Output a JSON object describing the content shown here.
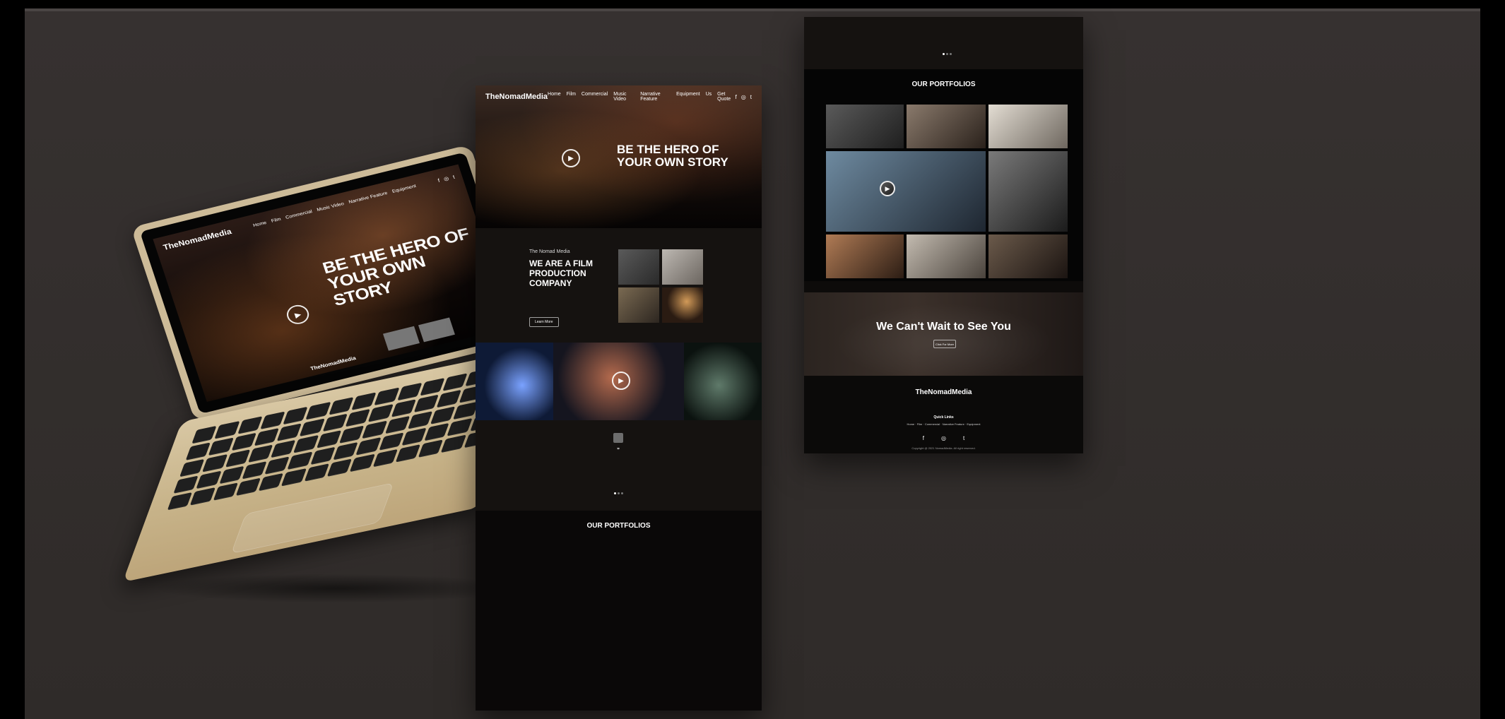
{
  "mockup": {
    "brand": "TheNomadMedia",
    "nav": [
      "Home",
      "Film",
      "Commercial",
      "Music Video",
      "Narrative Feature",
      "Equipment",
      "Us",
      "Get Quote"
    ],
    "social_icons": [
      "facebook-icon",
      "instagram-icon",
      "twitter-icon"
    ],
    "hero": {
      "headline": "BE THE HERO OF YOUR OWN STORY"
    },
    "about": {
      "kicker": "The Nomad Media",
      "headline": "WE ARE A FILM PRODUCTION COMPANY",
      "cta": "Learn More"
    },
    "sections": {
      "portfolio_title": "OUR PORTFOLIOS",
      "cta_title": "We Can't Wait to See You",
      "cta_button": "Click For More",
      "quick_links_title": "Quick Links"
    },
    "footer": {
      "copyright": "Copyright @ 2021 NomadMedia. All right reserved."
    }
  }
}
